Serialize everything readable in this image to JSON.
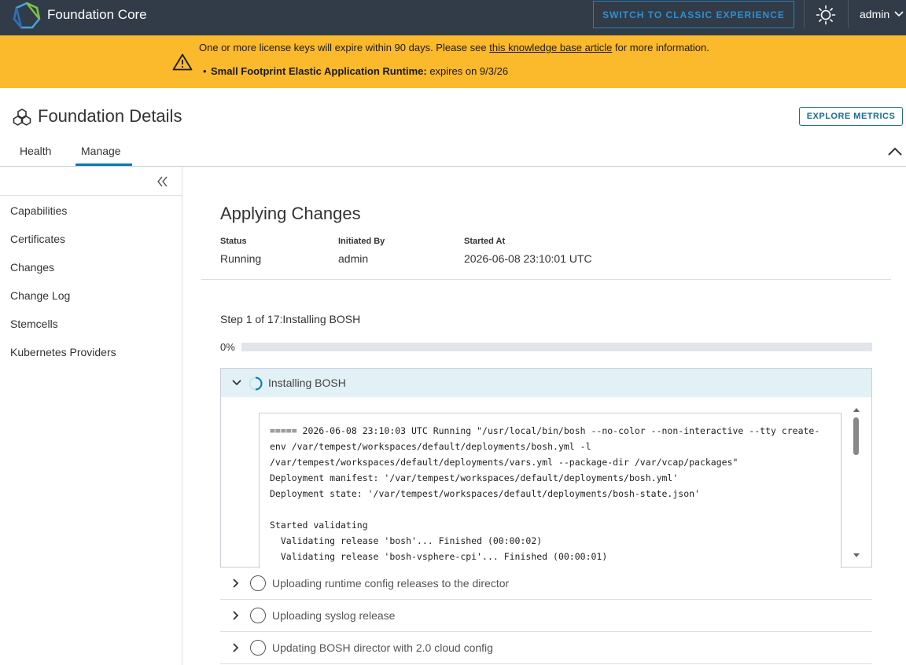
{
  "header": {
    "app_title": "Foundation Core",
    "classic_button": "SWITCH TO CLASSIC EXPERIENCE",
    "theme_icon": "sun-icon",
    "user": "admin"
  },
  "banner": {
    "message_prefix": "One or more license keys will expire within 90 days. Please see ",
    "link_text": "this knowledge base article",
    "message_suffix": " for more information.",
    "item_name": "Small Footprint Elastic Application Runtime:",
    "item_expiry": " expires on 9/3/26",
    "color": "#fbb92c"
  },
  "page": {
    "title": "Foundation Details",
    "explore_button": "EXPLORE METRICS",
    "tabs": [
      {
        "label": "Health"
      },
      {
        "label": "Manage",
        "active": true
      }
    ]
  },
  "sidebar": {
    "items": [
      {
        "label": "Capabilities"
      },
      {
        "label": "Certificates"
      },
      {
        "label": "Changes"
      },
      {
        "label": "Change Log"
      },
      {
        "label": "Stemcells"
      },
      {
        "label": "Kubernetes Providers"
      }
    ]
  },
  "main": {
    "title": "Applying Changes",
    "status_label": "Status",
    "status_value": "Running",
    "initiated_label": "Initiated By",
    "initiated_value": "admin",
    "started_label": "Started At",
    "started_value": "2026-06-08 23:10:01 UTC",
    "step_title": "Step 1 of 17:Installing BOSH",
    "progress_text": "0%",
    "progress_fraction": 0,
    "accent_color": "#0079b8"
  },
  "steps": {
    "current": {
      "label": "Installing BOSH",
      "log_lines": [
        "===== 2026-06-08 23:10:03 UTC Running \"/usr/local/bin/bosh --no-color --non-interactive --tty create-",
        "env /var/tempest/workspaces/default/deployments/bosh.yml -l",
        "/var/tempest/workspaces/default/deployments/vars.yml --package-dir /var/vcap/packages\"",
        "Deployment manifest: '/var/tempest/workspaces/default/deployments/bosh.yml'",
        "Deployment state: '/var/tempest/workspaces/default/deployments/bosh-state.json'",
        "",
        "Started validating",
        "  Validating release 'bosh'... Finished (00:00:02)",
        "  Validating release 'bosh-vsphere-cpi'... Finished (00:00:01)"
      ]
    },
    "pending": [
      {
        "label": "Uploading runtime config releases to the director"
      },
      {
        "label": "Uploading syslog release"
      },
      {
        "label": "Updating BOSH director with 2.0 cloud config"
      }
    ]
  }
}
